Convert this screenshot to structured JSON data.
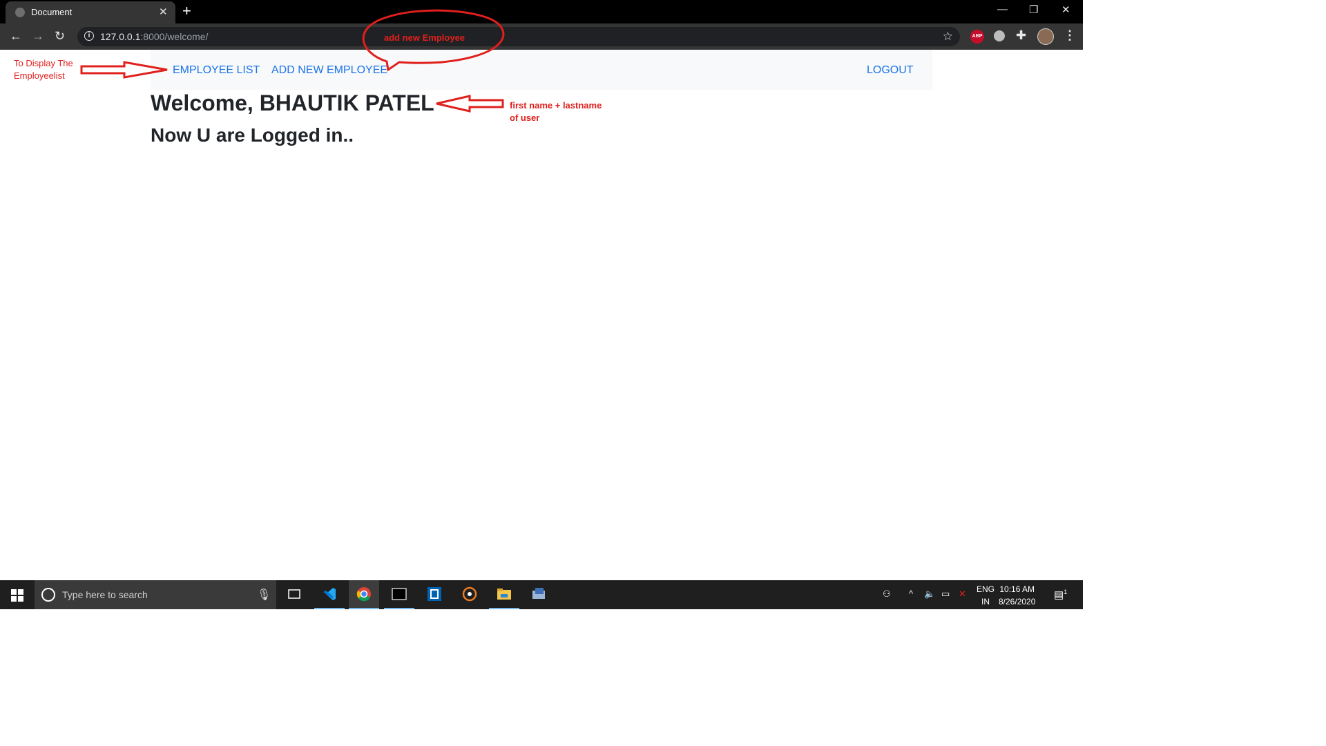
{
  "browser": {
    "tab_title": "Document",
    "url_host": "127.0.0.1",
    "url_rest": ":8000/welcome/"
  },
  "navbar": {
    "employee_list": "EMPLOYEE LIST",
    "add_new_employee": "ADD NEW EMPLOYEE",
    "logout": "LOGOUT"
  },
  "page": {
    "welcome": "Welcome, BHAUTIK PATEL",
    "logged_in": "Now U are Logged in.."
  },
  "annotations": {
    "employee_list_note": "To Display The Employeelist",
    "add_employee_note": "add new Employee",
    "name_note": "first name + lastname of user"
  },
  "taskbar": {
    "search_placeholder": "Type here to search",
    "lang_top": "ENG",
    "lang_bottom": "IN",
    "time": "10:16 AM",
    "date": "8/26/2020",
    "notification_count": "1"
  },
  "colors": {
    "annotation": "#e0201c",
    "link": "#1a73e8",
    "heading": "#212529"
  }
}
